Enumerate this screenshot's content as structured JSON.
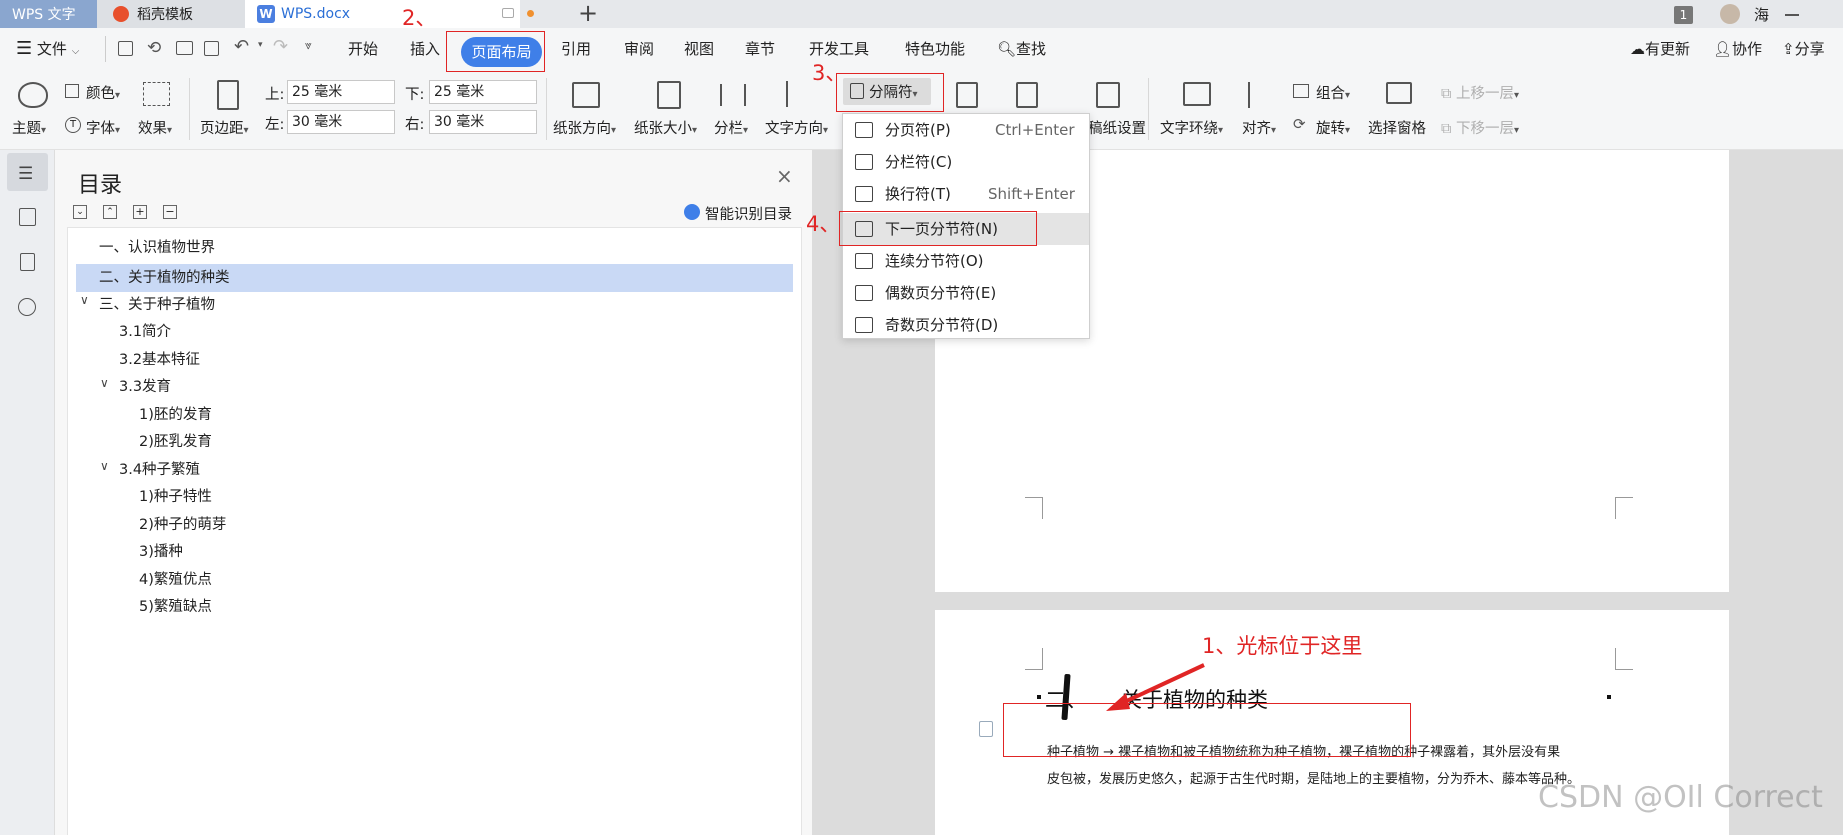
{
  "tabs": {
    "app": "WPS 文字",
    "template": "稻壳模板",
    "doc": "WPS.docx",
    "doc_icon": "W",
    "page_badge": "1",
    "user": "海"
  },
  "menu": {
    "file": "文件",
    "items": [
      "开始",
      "插入",
      "页面布局",
      "引用",
      "审阅",
      "视图",
      "章节",
      "开发工具",
      "特色功能"
    ],
    "search": "查找",
    "update": "有更新",
    "collab": "协作",
    "share": "分享"
  },
  "ribbon": {
    "theme": "主题",
    "color": "颜色",
    "font": "字体",
    "effect": "效果",
    "margin": "页边距",
    "top_label": "上:",
    "bottom_label": "下:",
    "left_label": "左:",
    "right_label": "右:",
    "top_value": "25 毫米",
    "bottom_value": "25 毫米",
    "left_value": "30 毫米",
    "right_value": "30 毫米",
    "orientation": "纸张方向",
    "size": "纸张大小",
    "columns": "分栏",
    "text_direction": "文字方向",
    "breaks": "分隔符",
    "paper_setup": "稿纸设置",
    "wrap": "文字环绕",
    "align": "对齐",
    "group": "组合",
    "rotate": "旋转",
    "selection_pane": "选择窗格",
    "bring_forward": "上移一层",
    "send_backward": "下移一层"
  },
  "toc": {
    "title": "目录",
    "smart": "智能识别目录",
    "items": [
      "一、认识植物世界",
      "二、关于植物的种类",
      "三、关于种子植物",
      "3.1简介",
      "3.2基本特征",
      "3.3发育",
      "1)胚的发育",
      "2)胚乳发育",
      "3.4种子繁殖",
      "1)种子特性",
      "2)种子的萌芽",
      "3)播种",
      "4)繁殖优点",
      "5)繁殖缺点"
    ]
  },
  "dropdown": {
    "items": [
      {
        "label": "分页符(P)",
        "shortcut": "Ctrl+Enter"
      },
      {
        "label": "分栏符(C)",
        "shortcut": ""
      },
      {
        "label": "换行符(T)",
        "shortcut": "Shift+Enter"
      },
      {
        "label": "下一页分节符(N)",
        "shortcut": ""
      },
      {
        "label": "连续分节符(O)",
        "shortcut": ""
      },
      {
        "label": "偶数页分节符(E)",
        "shortcut": ""
      },
      {
        "label": "奇数页分节符(D)",
        "shortcut": ""
      }
    ]
  },
  "annotations": {
    "step1": "1、光标位于这里",
    "step2": "2、",
    "step3": "3、",
    "step4": "4、"
  },
  "document": {
    "heading_num": "二、",
    "heading_text": "关于植物的种类",
    "body_line1": "种子植物 → 裸子植物和被子植物统称为种子植物，裸子植物的种子裸露着，其外层没有果",
    "body_line2": "皮包被，发展历史悠久，起源于古生代时期，是陆地上的主要植物，分为乔木、藤本等品种。"
  },
  "watermark": "CSDN @OIl Correct",
  "colors": {
    "accent": "#3f7fe8",
    "annotation": "#e02525",
    "toc_selected": "#c9d9f5"
  }
}
